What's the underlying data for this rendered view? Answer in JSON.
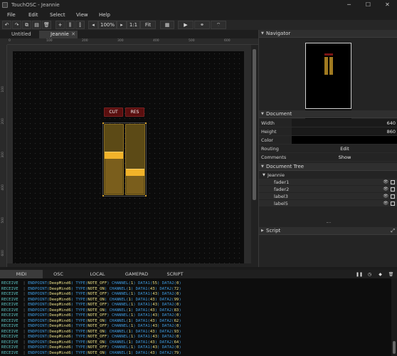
{
  "window": {
    "title": "TouchOSC - Jeannie",
    "min": "─",
    "max": "☐",
    "close": "✕"
  },
  "menu": [
    "File",
    "Edit",
    "Select",
    "View",
    "Help"
  ],
  "toolbar": {
    "zoom": "100%",
    "zoom_dec": "◂",
    "zoom_inc": "▸",
    "ratio": "1:1",
    "fit": "Fit",
    "play": "▶"
  },
  "doc_tabs": [
    {
      "label": "Untitled"
    },
    {
      "label": "Jeannie",
      "close": "✕"
    }
  ],
  "rulers": {
    "h": [
      "0",
      "100",
      "200",
      "300",
      "400",
      "500",
      "600"
    ],
    "v": [
      "100",
      "200",
      "300",
      "400",
      "500",
      "600",
      "700"
    ]
  },
  "canvas": {
    "labels": [
      {
        "text": "CUT"
      },
      {
        "text": "RES"
      }
    ],
    "faders": [
      {
        "name": "fader1",
        "value": 0.58
      },
      {
        "name": "fader2",
        "value": 0.3
      }
    ],
    "colors": {
      "label_bg": "#5a0f0f",
      "fader_bg": "#5c4a16",
      "fader_handle": "#f1b32a"
    }
  },
  "navigator": {
    "title": "Navigator"
  },
  "document": {
    "title": "Document",
    "width_label": "Width",
    "width": "640",
    "height_label": "Height",
    "height": "860",
    "color_label": "Color",
    "routing_label": "Routing",
    "routing_btn": "Edit",
    "comments_label": "Comments",
    "comments_btn": "Show"
  },
  "tree": {
    "title": "Document Tree",
    "root": "Jeannie",
    "items": [
      "fader1",
      "fader2",
      "label3",
      "label5"
    ],
    "eye": "👁"
  },
  "script": {
    "title": "Script"
  },
  "bottom_tabs": [
    "MIDI",
    "OSC",
    "LOCAL",
    "GAMEPAD",
    "SCRIPT"
  ],
  "log": [
    {
      "dir": "RECEIVE",
      "ep": "DeepMind6",
      "type": "NOTE_OFF",
      "ch": "1",
      "d1": "55",
      "d2": "0"
    },
    {
      "dir": "RECEIVE",
      "ep": "DeepMind6",
      "type": "NOTE_ON",
      "ch": "1",
      "d1": "43",
      "d2": "72"
    },
    {
      "dir": "RECEIVE",
      "ep": "DeepMind6",
      "type": "NOTE_OFF",
      "ch": "1",
      "d1": "43",
      "d2": "0"
    },
    {
      "dir": "RECEIVE",
      "ep": "DeepMind6",
      "type": "NOTE_ON",
      "ch": "1",
      "d1": "43",
      "d2": "99"
    },
    {
      "dir": "RECEIVE",
      "ep": "DeepMind6",
      "type": "NOTE_OFF",
      "ch": "1",
      "d1": "43",
      "d2": "0"
    },
    {
      "dir": "RECEIVE",
      "ep": "DeepMind6",
      "type": "NOTE_ON",
      "ch": "1",
      "d1": "43",
      "d2": "83"
    },
    {
      "dir": "RECEIVE",
      "ep": "DeepMind6",
      "type": "NOTE_OFF",
      "ch": "1",
      "d1": "43",
      "d2": "0"
    },
    {
      "dir": "RECEIVE",
      "ep": "DeepMind6",
      "type": "NOTE_ON",
      "ch": "1",
      "d1": "43",
      "d2": "62"
    },
    {
      "dir": "RECEIVE",
      "ep": "DeepMind6",
      "type": "NOTE_OFF",
      "ch": "1",
      "d1": "43",
      "d2": "0"
    },
    {
      "dir": "RECEIVE",
      "ep": "DeepMind6",
      "type": "NOTE_ON",
      "ch": "1",
      "d1": "43",
      "d2": "93"
    },
    {
      "dir": "RECEIVE",
      "ep": "DeepMind6",
      "type": "NOTE_OFF",
      "ch": "1",
      "d1": "43",
      "d2": "0"
    },
    {
      "dir": "RECEIVE",
      "ep": "DeepMind6",
      "type": "NOTE_ON",
      "ch": "1",
      "d1": "43",
      "d2": "64"
    },
    {
      "dir": "RECEIVE",
      "ep": "DeepMind6",
      "type": "NOTE_OFF",
      "ch": "1",
      "d1": "43",
      "d2": "0"
    },
    {
      "dir": "RECEIVE",
      "ep": "DeepMind6",
      "type": "NOTE_ON",
      "ch": "1",
      "d1": "43",
      "d2": "79"
    }
  ]
}
